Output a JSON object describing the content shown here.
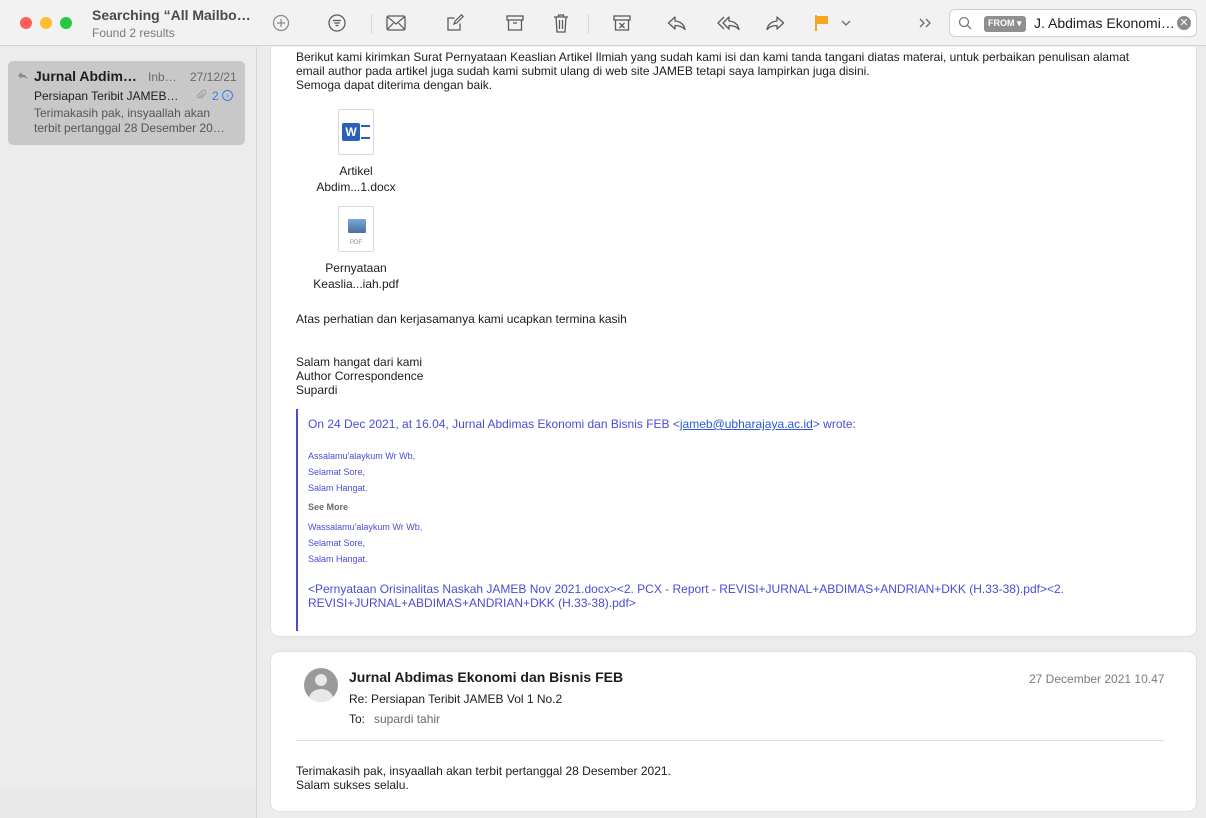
{
  "window": {
    "title": "Searching “All Mailbo…",
    "subtitle": "Found 2 results"
  },
  "toolbar": {
    "icons": [
      "add-icon",
      "filter-icon",
      "new-message-icon",
      "compose-icon",
      "archive-icon",
      "trash-icon",
      "junk-icon",
      "reply-icon",
      "reply-all-icon",
      "forward-icon",
      "flag-icon",
      "chevron-down-icon",
      "more-icon"
    ],
    "flag_color": "#f5a623"
  },
  "search": {
    "token": "FROM",
    "text": "J. Abdimas Ekonomi…"
  },
  "message_list": [
    {
      "sender": "Jurnal Abdim…",
      "mailbox": "Inb…",
      "date": "27/12/21",
      "subject": "Persiapan Teribit JAMEB…",
      "count": "2",
      "preview": "Terimakasih pak, insyaallah akan terbit pertanggal 28 Desember 20…"
    }
  ],
  "email1": {
    "body_lines": [
      "Berikut kami kirimkan Surat Pernyataan Keaslian Artikel Ilmiah yang sudah kami isi dan kami tanda tangani diatas materai, untuk perbaikan penulisan alamat",
      "email author pada artikel juga sudah  kami submit ulang di web site JAMEB tetapi saya lampirkan juga disini.",
      "Semoga dapat diterima dengan baik."
    ],
    "attachments": [
      {
        "line1": "Artikel",
        "line2": "Abdim...1.docx",
        "type": "docx"
      },
      {
        "line1": "Pernyataan",
        "line2": "Keaslia...iah.pdf",
        "type": "pdf"
      }
    ],
    "pdf_label": "PDF",
    "closing": "Atas perhatian dan kerjasamanya kami ucapkan termina kasih",
    "signature": [
      "Salam hangat dari kami",
      "Author Correspondence",
      "Supardi"
    ],
    "quote": {
      "header_prefix": "On 24 Dec 2021, at 16.04, Jurnal Abdimas Ekonomi dan Bisnis FEB <",
      "header_email": "jameb@ubharajaya.ac.id",
      "header_suffix": "> wrote:",
      "greeting": [
        "Assalamu'alaykum Wr Wb,",
        "Selamat Sore,",
        "Salam Hangat."
      ],
      "see_more": "See More",
      "closing": [
        "Wassalamu'alaykum Wr Wb,",
        "Selamat Sore,",
        "Salam Hangat."
      ],
      "attachments_line1": "<Pernyataan Orisinalitas Naskah JAMEB Nov 2021.docx><2. PCX - Report - REVISI+JURNAL+ABDIMAS+ANDRIAN+DKK (H.33-38).pdf><2.",
      "attachments_line2": "REVISI+JURNAL+ABDIMAS+ANDRIAN+DKK (H.33-38).pdf>"
    }
  },
  "email2": {
    "sender": "Jurnal Abdimas Ekonomi dan Bisnis FEB",
    "date": "27 December 2021 10.47",
    "subject": "Re: Persiapan Teribit JAMEB Vol 1 No.2",
    "to_label": "To:",
    "to_value": "supardi tahir",
    "body_lines": [
      "Terimakasih pak, insyaallah akan terbit pertanggal 28 Desember 2021.",
      "Salam sukses selalu."
    ]
  }
}
